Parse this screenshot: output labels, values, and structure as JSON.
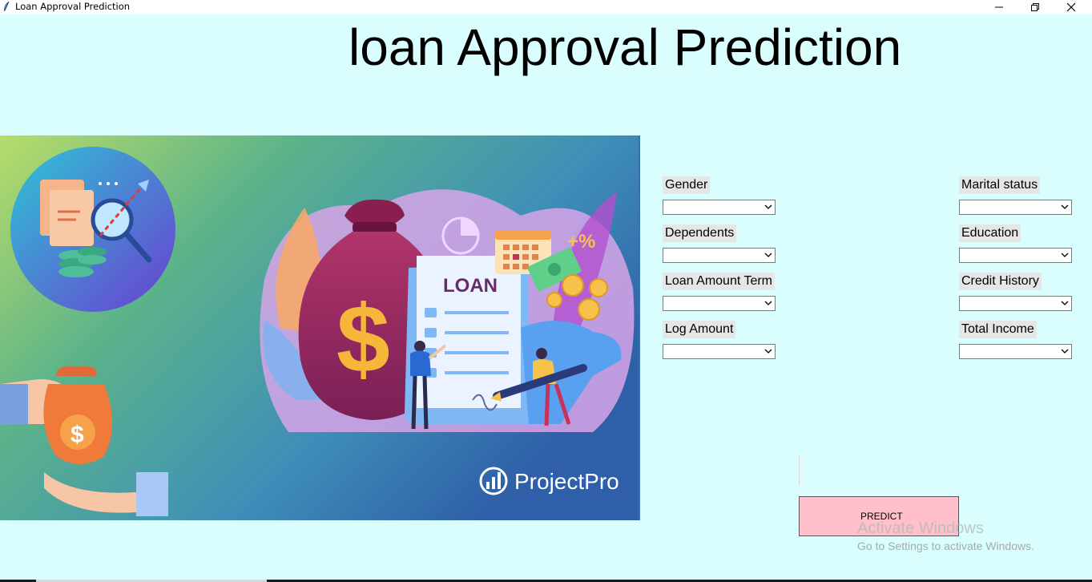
{
  "window": {
    "title": "Loan Approval Prediction",
    "controls": [
      "minimize-icon",
      "restore-icon",
      "close-icon"
    ]
  },
  "heading": "loan Approval Prediction",
  "banner": {
    "image_text": "LOAN",
    "brand": "ProjectPro",
    "percent_tag": "+%",
    "dollar_sign": "$",
    "colors": {
      "gradient_left": "#b8dc6a",
      "gradient_right": "#2e5fa8"
    }
  },
  "form": {
    "fields": [
      {
        "label": "Gender",
        "value": ""
      },
      {
        "label": "Marital status",
        "value": ""
      },
      {
        "label": "Dependents",
        "value": ""
      },
      {
        "label": "Education",
        "value": ""
      },
      {
        "label": "Loan Amount Term",
        "value": ""
      },
      {
        "label": "Credit History",
        "value": ""
      },
      {
        "label": "Log Amount",
        "value": ""
      },
      {
        "label": "Total Income",
        "value": ""
      }
    ],
    "predict_label": "PREDICT",
    "predict_color": "#ffc0cb"
  },
  "watermark": {
    "line1": "Activate Windows",
    "line2": "Go to Settings to activate Windows."
  },
  "colors": {
    "background": "#dafefe"
  }
}
